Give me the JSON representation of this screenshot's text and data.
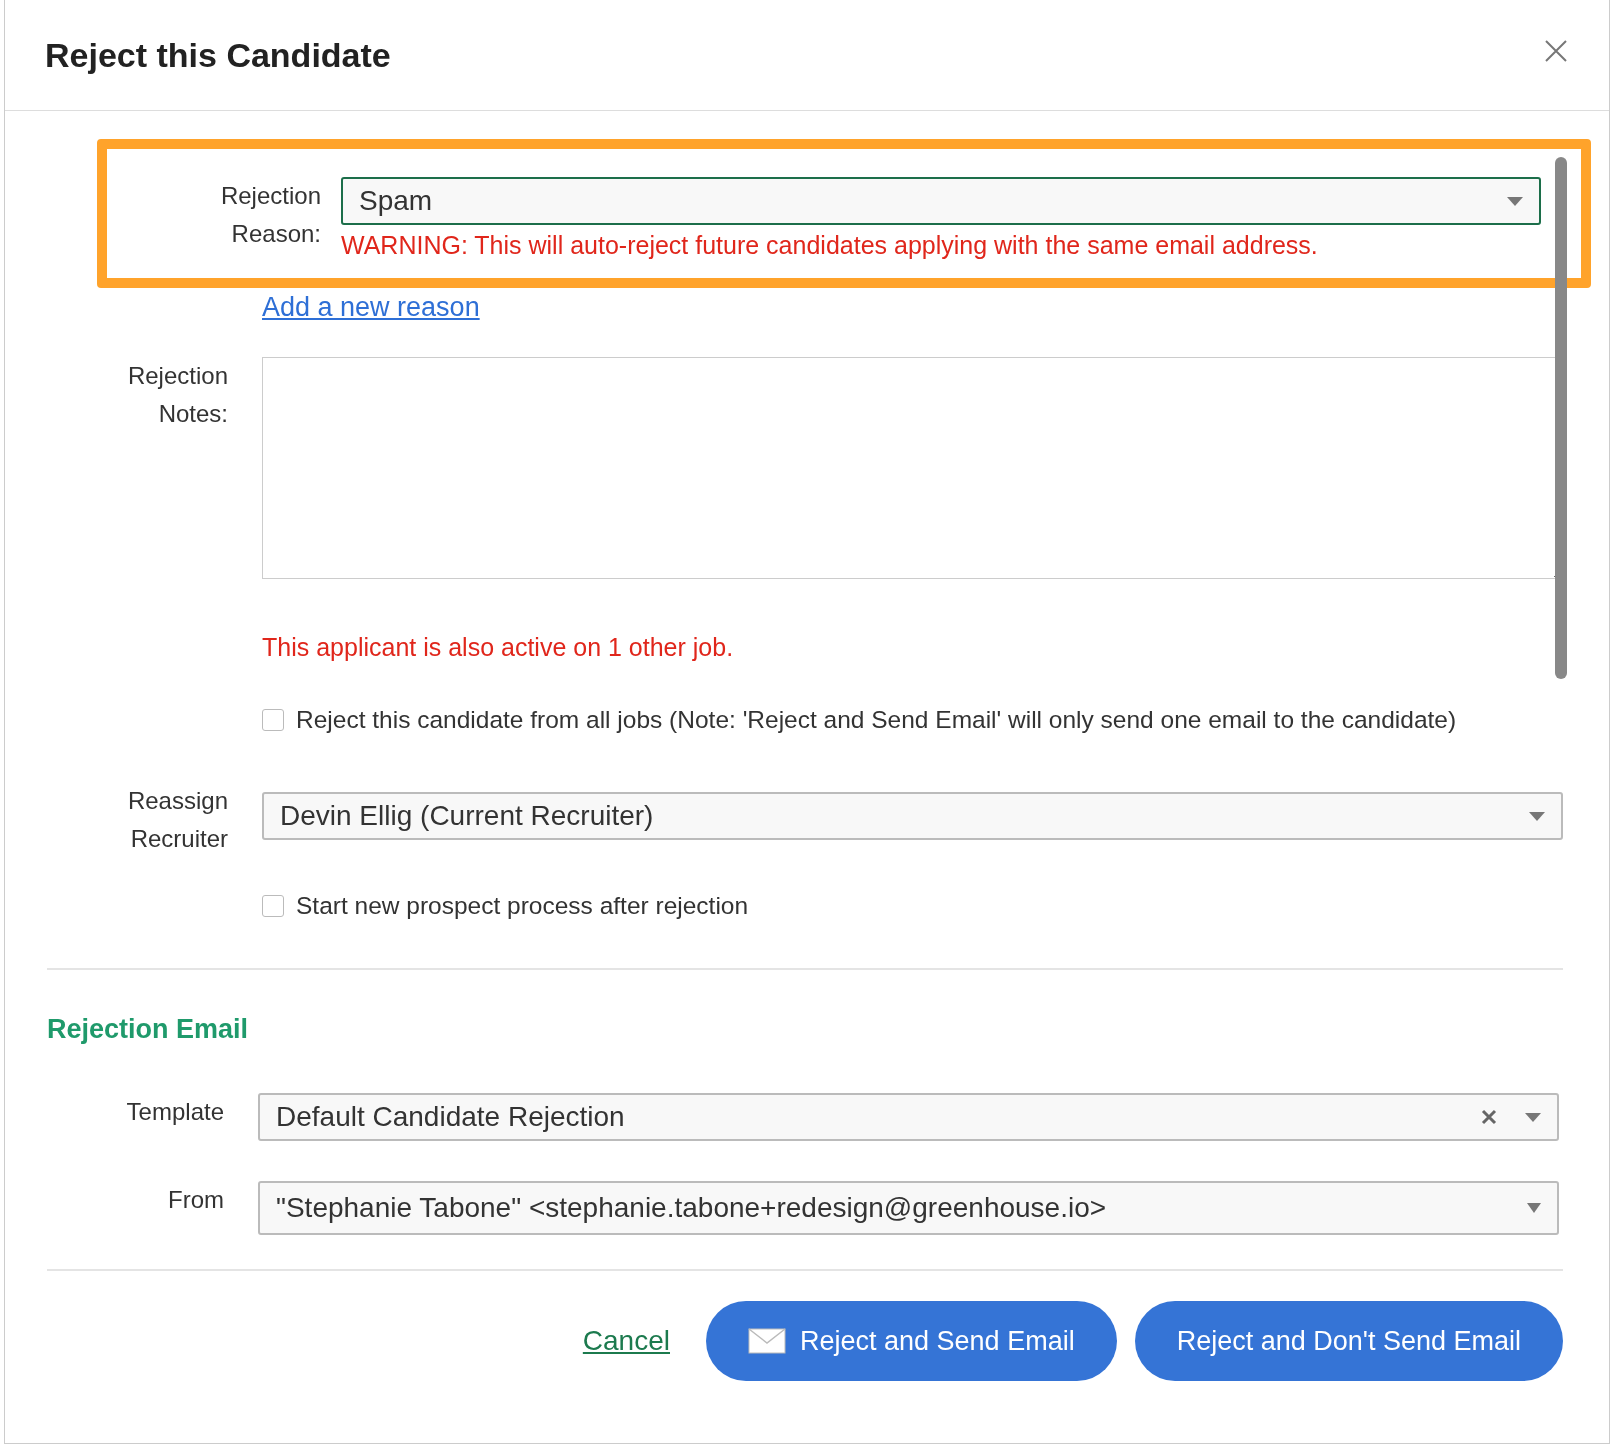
{
  "dialog": {
    "title": "Reject this Candidate"
  },
  "rejection_reason": {
    "label": "Rejection Reason:",
    "value": "Spam",
    "warning": "WARNING: This will auto-reject future candidates applying with the same email address.",
    "highlighted": true,
    "add_link": "Add a new reason"
  },
  "rejection_notes": {
    "label": "Rejection Notes:"
  },
  "active_notice": "This applicant is also active on 1 other job.",
  "reject_all": {
    "label": "Reject this candidate from all jobs (Note: 'Reject and Send Email' will only send one email to the candidate)",
    "checked": false
  },
  "reassign_recruiter": {
    "label": "Reassign Recruiter",
    "value": "Devin Ellig (Current Recruiter)"
  },
  "prospect": {
    "label": "Start new prospect process after rejection",
    "checked": false
  },
  "rejection_email": {
    "title": "Rejection Email",
    "template": {
      "label": "Template",
      "value": "Default Candidate Rejection",
      "clearable": true
    },
    "from": {
      "label": "From",
      "value": "\"Stephanie Tabone\" <stephanie.tabone+redesign@greenhouse.io>"
    }
  },
  "buttons": {
    "cancel": "Cancel",
    "send": "Reject and Send Email",
    "no_send": "Reject and Don't Send Email"
  }
}
